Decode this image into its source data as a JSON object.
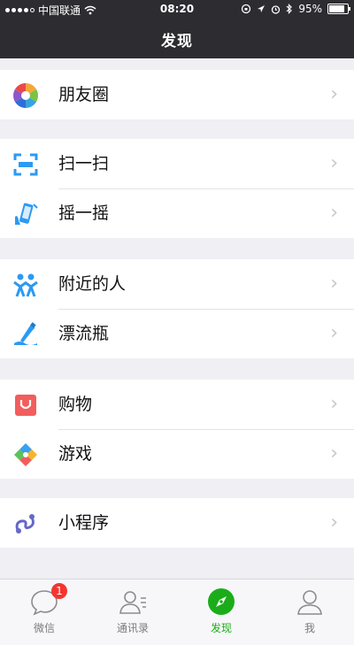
{
  "status_bar": {
    "carrier": "中国联通",
    "time": "08:20",
    "battery": "95%",
    "battery_level": 0.95
  },
  "nav": {
    "title": "发现"
  },
  "groups": [
    {
      "items": [
        {
          "label": "朋友圈",
          "icon": "moments-icon"
        }
      ]
    },
    {
      "items": [
        {
          "label": "扫一扫",
          "icon": "scan-icon"
        },
        {
          "label": "摇一摇",
          "icon": "shake-icon"
        }
      ]
    },
    {
      "items": [
        {
          "label": "附近的人",
          "icon": "people-nearby-icon"
        },
        {
          "label": "漂流瓶",
          "icon": "drift-bottle-icon"
        }
      ]
    },
    {
      "items": [
        {
          "label": "购物",
          "icon": "shopping-icon"
        },
        {
          "label": "游戏",
          "icon": "games-icon"
        }
      ]
    },
    {
      "items": [
        {
          "label": "小程序",
          "icon": "mini-programs-icon"
        }
      ]
    }
  ],
  "chevron": "›",
  "tabs": [
    {
      "label": "微信",
      "icon": "chats-icon",
      "badge": "1"
    },
    {
      "label": "通讯录",
      "icon": "contacts-icon"
    },
    {
      "label": "发现",
      "icon": "discover-icon",
      "active": true
    },
    {
      "label": "我",
      "icon": "me-icon"
    }
  ],
  "colors": {
    "bar_bg": "#2d2c31",
    "page_bg": "#efeff4",
    "active_tab": "#1aad19",
    "badge": "#f43530"
  }
}
